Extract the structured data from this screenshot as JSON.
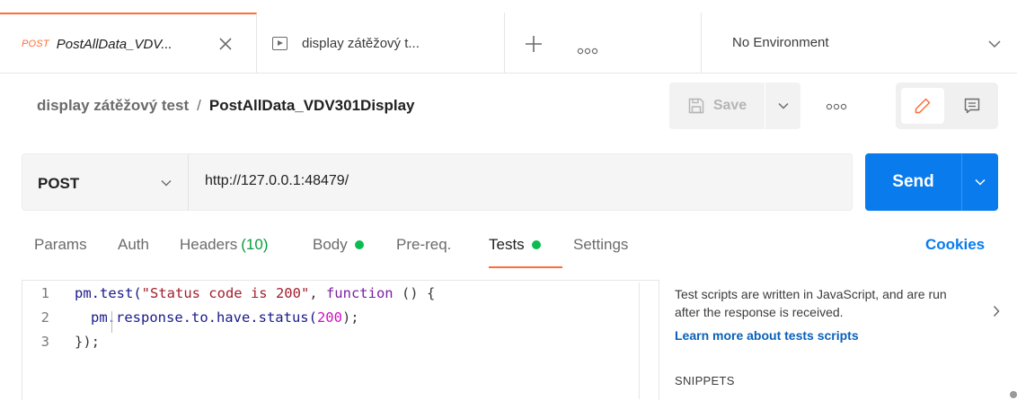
{
  "tabs": [
    {
      "method": "POST",
      "name": "PostAllData_VDV...",
      "active": true,
      "icon": "close-icon"
    },
    {
      "icon": "runner-icon",
      "name": "display zátěžový t..."
    }
  ],
  "tabbar": {
    "new_tab_icon": "plus-icon",
    "more_icon": "more-horizontal-icon"
  },
  "environment": {
    "selected": "No Environment",
    "icon": "chevron-down-icon"
  },
  "breadcrumb": {
    "collection": "display zátěžový test",
    "separator": "/",
    "request": "PostAllData_VDV301Display"
  },
  "toolbar": {
    "save_label": "Save",
    "save_icon": "save-icon",
    "mode_icons": [
      "pencil-icon",
      "comment-icon"
    ]
  },
  "request": {
    "method": "POST",
    "url": "http://127.0.0.1:48479/",
    "send_label": "Send"
  },
  "request_tabs": [
    {
      "label": "Params"
    },
    {
      "label": "Auth"
    },
    {
      "label": "Headers",
      "count": "(10)"
    },
    {
      "label": "Body",
      "indicator": true
    },
    {
      "label": "Pre-req."
    },
    {
      "label": "Tests",
      "indicator": true,
      "active": true
    },
    {
      "label": "Settings"
    }
  ],
  "cookies_label": "Cookies",
  "editor": {
    "line_numbers": [
      "1",
      "2",
      "3"
    ],
    "line1": {
      "p1": "pm.test(",
      "s1": "\"Status code is 200\"",
      "p2": ", ",
      "kw": "function",
      "p3": " () {"
    },
    "line2": {
      "p1": "pm.response.to.have.status(",
      "n1": "200",
      "p2": ");"
    },
    "line3": {
      "p1": "});"
    }
  },
  "side_panel": {
    "description": "Test scripts are written in JavaScript, and are run after the response is received.",
    "link": "Learn more about tests scripts",
    "snippets_heading": "SNIPPETS"
  },
  "colors": {
    "accent": "#ff6c37",
    "send": "#097bed",
    "indicator": "#0cbb52",
    "link": "#0960b8"
  }
}
